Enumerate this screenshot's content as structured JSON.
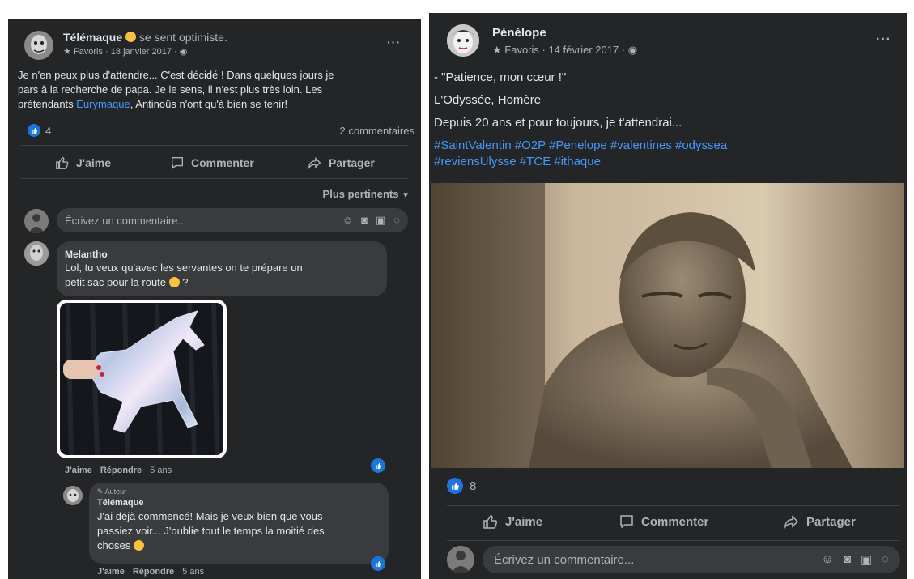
{
  "left_post": {
    "author": "Télémaque",
    "feeling": "se sent optimiste.",
    "meta": "Favoris · 18 janvier 2017 ·",
    "body_line1": "Je n'en peux plus d'attendre... C'est décidé ! Dans quelques jours je",
    "body_line2": "pars à la recherche de papa. Je le sens, il n'est plus très loin. Les",
    "body_line3_pre": "prétendants ",
    "body_line3_link": "Eurymaque",
    "body_line3_post": ", Antinoüs n'ont qu'à bien se tenir!",
    "reactions": "4",
    "comments_count": "2 commentaires",
    "actions": {
      "like": "J'aime",
      "comment": "Commenter",
      "share": "Partager"
    },
    "sort_label": "Plus pertinents",
    "comment_placeholder": "Écrivez un commentaire...",
    "comments": [
      {
        "author": "Melantho",
        "line1": "Lol, tu veux qu'avec les servantes on te prépare un",
        "line2": "petit sac pour la route",
        "line2_end": " ?",
        "like": "J'aime",
        "reply": "Répondre",
        "time": "5 ans"
      },
      {
        "badge": "Auteur",
        "author": "Télémaque",
        "line1": "J'ai déjà commencé! Mais je veux bien que vous",
        "line2": "passiez voir... J'oublie tout le temps la moitié des",
        "line3": "choses",
        "like": "J'aime",
        "reply": "Répondre",
        "time": "5 ans"
      }
    ]
  },
  "right_post": {
    "author": "Pénélope",
    "meta": "Favoris · 14 février 2017 ·",
    "line1": "- \"Patience, mon cœur !\"",
    "line2": "L'Odyssée, Homère",
    "line3": "Depuis 20 ans et pour toujours, je t'attendrai...",
    "hashtags1": "#SaintValentin #O2P #Penelope #valentines #odyssea",
    "hashtags2": "#reviensUlysse #TCE #ithaque",
    "reactions": "8",
    "actions": {
      "like": "J'aime",
      "comment": "Commenter",
      "share": "Partager"
    },
    "comment_placeholder": "Écrivez un commentaire..."
  },
  "colors": {
    "panel": "#242526",
    "input": "#3a3b3c",
    "link": "#4599ff",
    "like": "#1b74e4"
  }
}
